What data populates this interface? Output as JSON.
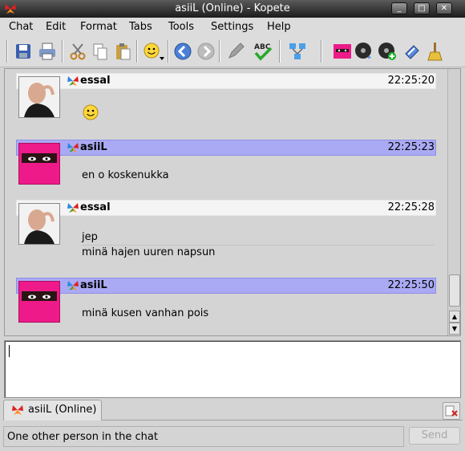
{
  "window": {
    "title": "asiiL (Online) - Kopete"
  },
  "menu": [
    "Chat",
    "Edit",
    "Format",
    "Tabs",
    "Tools",
    "Settings",
    "Help"
  ],
  "toolbar": {
    "icons": [
      "save-icon",
      "print-icon",
      "cut-icon",
      "copy-icon",
      "paste-icon",
      "emoticon-icon",
      "back-icon",
      "forward-icon",
      "pen-icon",
      "spellcheck-icon",
      "network-icon",
      "contact-picture-icon",
      "music-icon",
      "music-add-icon",
      "attach-icon",
      "clean-icon"
    ],
    "spellcheck_text": "ABC"
  },
  "messages": [
    {
      "nick": "essal",
      "time": "22:25:20",
      "lines": [],
      "emoticon": "smiley",
      "header_color": "#f4f4f4"
    },
    {
      "nick": "asiiL",
      "time": "22:25:23",
      "lines": [
        "en o koskenukka"
      ],
      "header_color": "#aaaaf4"
    },
    {
      "nick": "essal",
      "time": "22:25:28",
      "lines": [
        "jep",
        "minä hajen uuren napsun"
      ],
      "header_color": "#f4f4f4"
    },
    {
      "nick": "asiiL",
      "time": "22:25:50",
      "lines": [
        "minä kusen vanhan pois"
      ],
      "header_color": "#aaaaf4"
    }
  ],
  "input": {
    "value": ""
  },
  "tab": {
    "label": "asiiL (Online)"
  },
  "status": {
    "text": "One other person in the chat"
  },
  "send_button": {
    "label": "Send"
  },
  "colors": {
    "accent": "#aaaaf4",
    "pink_avatar": "#ee1a8a"
  }
}
